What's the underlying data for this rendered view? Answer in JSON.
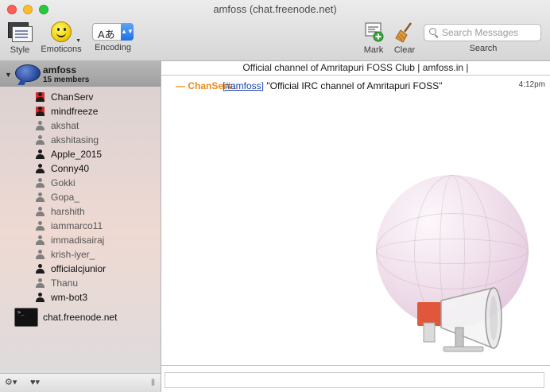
{
  "window": {
    "title": "amfoss (chat.freenode.net)"
  },
  "toolbar": {
    "style_label": "Style",
    "emoticons_label": "Emoticons",
    "encoding_label": "Encoding",
    "encoding_value": "Aあ",
    "mark_label": "Mark",
    "clear_label": "Clear",
    "search_label": "Search",
    "search_placeholder": "Search Messages"
  },
  "sidebar": {
    "channel": {
      "name": "amfoss",
      "member_count": "15 members"
    },
    "members": [
      {
        "nick": "ChanServ",
        "status": "service"
      },
      {
        "nick": "mindfreeze",
        "status": "service"
      },
      {
        "nick": "akshat",
        "status": "idle"
      },
      {
        "nick": "akshitasing",
        "status": "idle"
      },
      {
        "nick": "Apple_2015",
        "status": "op"
      },
      {
        "nick": "Conny40",
        "status": "op"
      },
      {
        "nick": "Gokki",
        "status": "idle"
      },
      {
        "nick": "Gopa_",
        "status": "idle"
      },
      {
        "nick": "harshith",
        "status": "idle"
      },
      {
        "nick": "iammarco11",
        "status": "idle"
      },
      {
        "nick": "immadisairaj",
        "status": "idle"
      },
      {
        "nick": "krish-iyer_",
        "status": "idle"
      },
      {
        "nick": "officialcjunior",
        "status": "op"
      },
      {
        "nick": "Thanu",
        "status": "idle"
      },
      {
        "nick": "wm-bot3",
        "status": "op"
      }
    ],
    "server": {
      "name": "chat.freenode.net"
    }
  },
  "chat": {
    "topic": "Official channel of Amritapuri FOSS Club | amfoss.in |",
    "messages": [
      {
        "sender": "— ChanServ:",
        "channel_link": "[#amfoss]",
        "text": " \"Official IRC channel of Amritapuri FOSS\"",
        "time": "4:12pm"
      }
    ]
  },
  "bottom": {
    "gear_label": "⚙▾",
    "heart_label": "♥▾",
    "grip": "|||"
  },
  "colors": {
    "sender": "#e88a1a",
    "channel_link": "#1a3fb0",
    "sidebar_selected": "#a9a9a9"
  },
  "icons": {
    "style": "style-icon",
    "emoticons": "smiley-icon",
    "mark": "mark-icon",
    "clear": "broom-icon",
    "search": "search-icon",
    "channel": "chat-bubble-icon",
    "server": "terminal-icon",
    "gear": "gear-icon",
    "heart": "heart-icon"
  }
}
